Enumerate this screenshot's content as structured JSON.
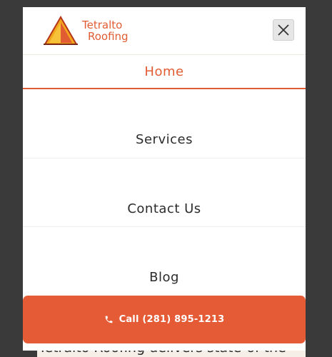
{
  "brand": {
    "name_line1": "Tetralto",
    "name_line2": "Roofing",
    "accent_color": "#e25c33"
  },
  "menu": {
    "items": [
      {
        "label": "Home",
        "active": true
      },
      {
        "label": "Services",
        "active": false
      },
      {
        "label": "Contact Us",
        "active": false
      },
      {
        "label": "Blog",
        "active": false
      }
    ],
    "close_icon": "close-icon"
  },
  "cta": {
    "label": "Call (281) 895-1213",
    "icon": "phone-icon",
    "color": "#e45b36"
  },
  "background_content": {
    "text": "Tetralto Roofing delivers state-of-the-"
  }
}
